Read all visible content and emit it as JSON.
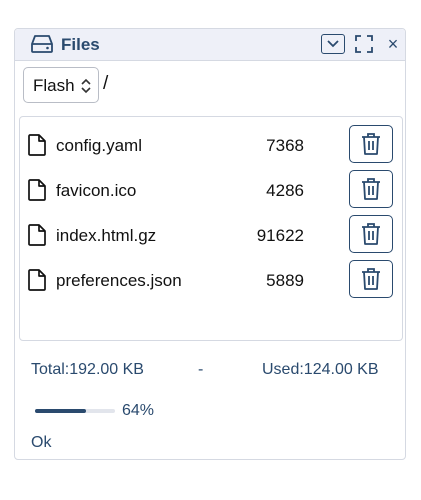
{
  "header": {
    "title": "Files",
    "icon": "storage-drive-icon",
    "controls": [
      "chevron-down-icon",
      "maximize-icon",
      "close-icon"
    ],
    "close_label": "×"
  },
  "filesystem": {
    "selected": "Flash",
    "path": "/"
  },
  "files": [
    {
      "name": "config.yaml",
      "size": "7368"
    },
    {
      "name": "favicon.ico",
      "size": "4286"
    },
    {
      "name": "index.html.gz",
      "size": "91622"
    },
    {
      "name": "preferences.json",
      "size": "5889"
    }
  ],
  "stats": {
    "total": "Total:192.00 KB",
    "separator": "-",
    "used": "Used:124.00 KB"
  },
  "progress": {
    "percent": 64,
    "label": "64%"
  },
  "footer": {
    "ok_label": "Ok"
  },
  "colors": {
    "accent": "#2a4a6e",
    "header_bg": "#eef0f8",
    "border": "#d5d9e2"
  }
}
